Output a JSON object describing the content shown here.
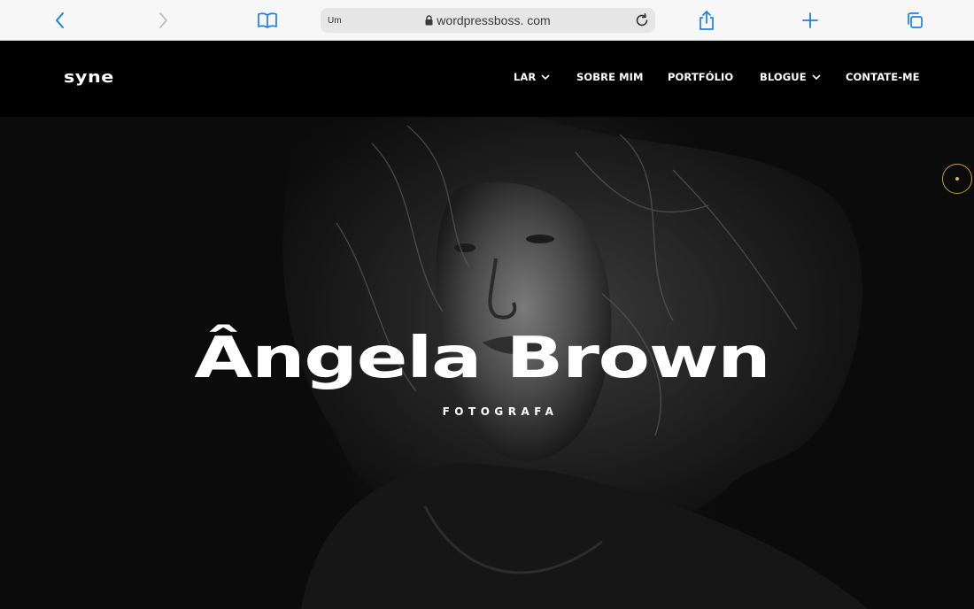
{
  "browser": {
    "address_prefix": "Um",
    "url": "wordpressboss. com",
    "icons": [
      "back-icon",
      "forward-icon",
      "bookmarks-icon",
      "lock-icon",
      "reload-icon",
      "share-icon",
      "new-tab-icon",
      "tabs-icon"
    ],
    "accent": "#1a7ff0"
  },
  "site": {
    "logo": "syne",
    "nav": [
      {
        "label": "LAR",
        "has_dropdown": true
      },
      {
        "label": "SOBRE MIM",
        "has_dropdown": false
      },
      {
        "label": "PORTFÓLIO",
        "has_dropdown": false
      },
      {
        "label": "BLOGUE",
        "has_dropdown": true
      },
      {
        "label": "CONTATE-ME",
        "has_dropdown": false
      }
    ]
  },
  "hero": {
    "title": "Ângela Brown",
    "subtitle": "FOTOGRAFA",
    "indicator_color": "#e6b422"
  }
}
